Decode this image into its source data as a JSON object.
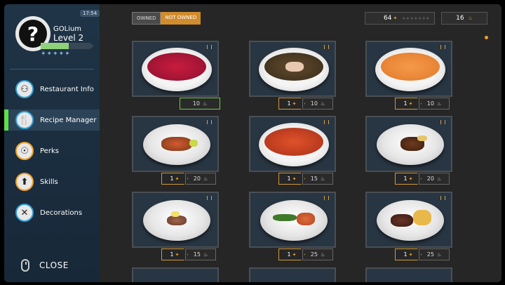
{
  "sidebar": {
    "clock": "17:54",
    "avatar_glyph": "?",
    "player_name": "GOLium",
    "player_level": "Level 2",
    "xp_progress": 0.52,
    "stars": "✦✦✦✦✦",
    "menu": [
      {
        "label": "Restaurant Info",
        "icon": "restaurant-info-icon",
        "glyph": "⚇"
      },
      {
        "label": "Recipe Manager",
        "icon": "recipe-manager-icon",
        "glyph": "🍴"
      },
      {
        "label": "Perks",
        "icon": "perks-icon",
        "glyph": "☉"
      },
      {
        "label": "Skills",
        "icon": "skills-icon",
        "glyph": "⬆"
      },
      {
        "label": "Decorations",
        "icon": "decorations-icon",
        "glyph": "✕"
      }
    ],
    "close_label": "CLOSE"
  },
  "filters": {
    "owned": "OWNED",
    "not_owned": "NOT OWNED"
  },
  "stats": {
    "stars_value": "64",
    "pots_value": "16"
  },
  "recipes": [
    {
      "dish": "beet-soup",
      "level": "",
      "cost": "10"
    },
    {
      "dish": "mushroom-soup",
      "level": "1",
      "cost": "10"
    },
    {
      "dish": "carrot-soup",
      "level": "1",
      "cost": "10"
    },
    {
      "dish": "shrimp-salad",
      "level": "1",
      "cost": "20"
    },
    {
      "dish": "tomato-soup",
      "level": "1",
      "cost": "15"
    },
    {
      "dish": "steak-plate",
      "level": "1",
      "cost": "20"
    },
    {
      "dish": "fish-fillet",
      "level": "1",
      "cost": "15"
    },
    {
      "dish": "salmon-asparagus",
      "level": "1",
      "cost": "25"
    },
    {
      "dish": "steak-fries",
      "level": "1",
      "cost": "25"
    }
  ],
  "colors": {
    "accent_orange": "#f0a024",
    "active_green": "#5fde4a",
    "sidebar_blue": "#1f3447"
  }
}
